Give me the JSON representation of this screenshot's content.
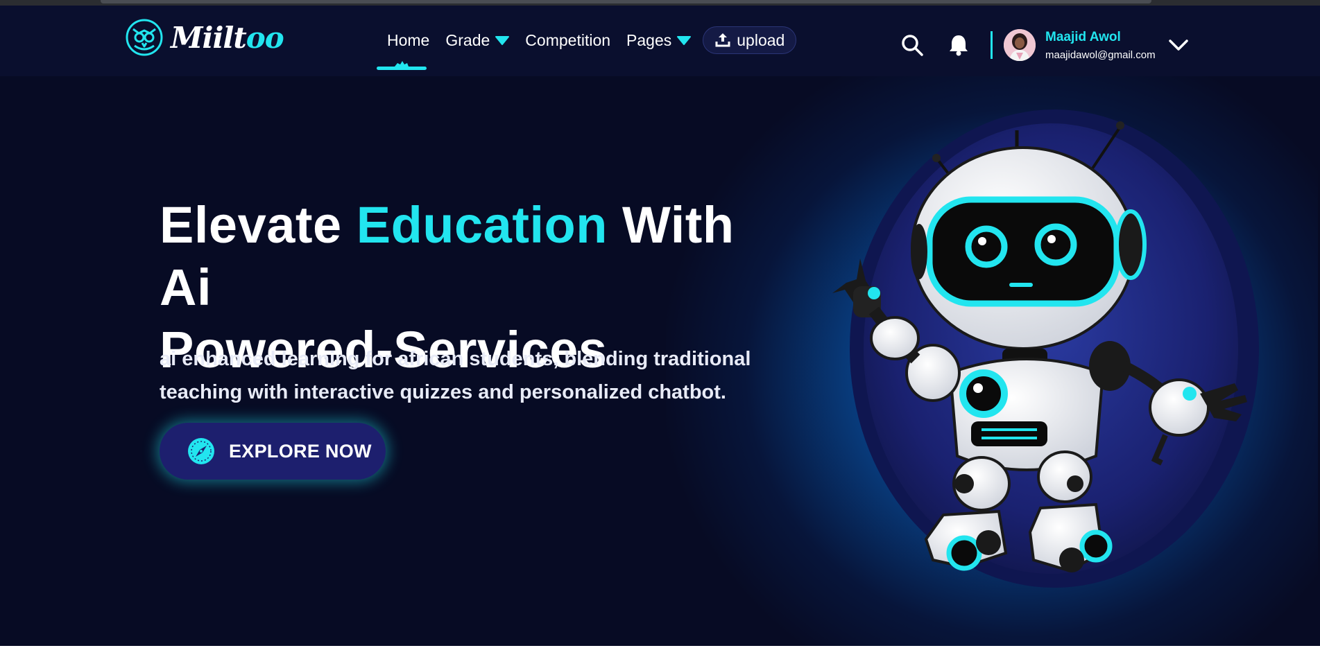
{
  "brand": {
    "name_main": "Miilt",
    "name_accent": "oo"
  },
  "nav": {
    "items": [
      {
        "label": "Home",
        "active": true,
        "has_dropdown": false
      },
      {
        "label": "Grade",
        "has_dropdown": true
      },
      {
        "label": "Competition",
        "has_dropdown": false
      },
      {
        "label": "Pages",
        "has_dropdown": true
      }
    ],
    "upload_label": "upload"
  },
  "header": {
    "icons": [
      "search-icon",
      "bell-icon",
      "chevron-down-icon",
      "upload-icon"
    ]
  },
  "user": {
    "name": "Maajid Awol",
    "email": "maajidawol@gmail.com"
  },
  "hero": {
    "title_part1": "Elevate ",
    "title_accent": "Education",
    "title_part2": " With Ai",
    "title_line2": "Powered-Services",
    "subtitle_line1": "ai enhanced learning for african students, blending traditional",
    "subtitle_line2": "teaching with interactive quizzes and personalized chatbot.",
    "cta_label": "EXPLORE NOW"
  },
  "colors": {
    "background": "#070b24",
    "header": "#0a0f2e",
    "accent": "#22e5ef",
    "button": "#1d1f6e"
  }
}
